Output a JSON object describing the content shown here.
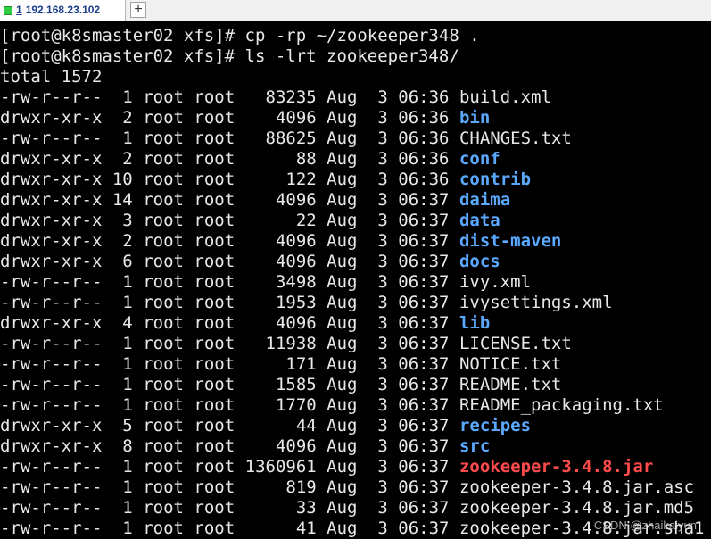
{
  "tab": {
    "index": "1",
    "title": "192.168.23.102",
    "status_color": "#2ecc40",
    "add_label": "+"
  },
  "terminal": {
    "lines": [
      {
        "kind": "text",
        "text": "[root@k8smaster02 xfs]# cp -rp ~/zookeeper348 ."
      },
      {
        "kind": "text",
        "text": "[root@k8smaster02 xfs]# ls -lrt zookeeper348/"
      },
      {
        "kind": "text",
        "text": "total 1572"
      },
      {
        "kind": "entry",
        "perms": "-rw-r--r--",
        "links": "1",
        "owner": "root",
        "group": "root",
        "size": "83235",
        "month": "Aug",
        "day": "3",
        "time": "06:36",
        "name": "build.xml",
        "type": "file"
      },
      {
        "kind": "entry",
        "perms": "drwxr-xr-x",
        "links": "2",
        "owner": "root",
        "group": "root",
        "size": "4096",
        "month": "Aug",
        "day": "3",
        "time": "06:36",
        "name": "bin",
        "type": "dir"
      },
      {
        "kind": "entry",
        "perms": "-rw-r--r--",
        "links": "1",
        "owner": "root",
        "group": "root",
        "size": "88625",
        "month": "Aug",
        "day": "3",
        "time": "06:36",
        "name": "CHANGES.txt",
        "type": "file"
      },
      {
        "kind": "entry",
        "perms": "drwxr-xr-x",
        "links": "2",
        "owner": "root",
        "group": "root",
        "size": "88",
        "month": "Aug",
        "day": "3",
        "time": "06:36",
        "name": "conf",
        "type": "dir"
      },
      {
        "kind": "entry",
        "perms": "drwxr-xr-x",
        "links": "10",
        "owner": "root",
        "group": "root",
        "size": "122",
        "month": "Aug",
        "day": "3",
        "time": "06:36",
        "name": "contrib",
        "type": "dir"
      },
      {
        "kind": "entry",
        "perms": "drwxr-xr-x",
        "links": "14",
        "owner": "root",
        "group": "root",
        "size": "4096",
        "month": "Aug",
        "day": "3",
        "time": "06:37",
        "name": "daima",
        "type": "dir"
      },
      {
        "kind": "entry",
        "perms": "drwxr-xr-x",
        "links": "3",
        "owner": "root",
        "group": "root",
        "size": "22",
        "month": "Aug",
        "day": "3",
        "time": "06:37",
        "name": "data",
        "type": "dir"
      },
      {
        "kind": "entry",
        "perms": "drwxr-xr-x",
        "links": "2",
        "owner": "root",
        "group": "root",
        "size": "4096",
        "month": "Aug",
        "day": "3",
        "time": "06:37",
        "name": "dist-maven",
        "type": "dir"
      },
      {
        "kind": "entry",
        "perms": "drwxr-xr-x",
        "links": "6",
        "owner": "root",
        "group": "root",
        "size": "4096",
        "month": "Aug",
        "day": "3",
        "time": "06:37",
        "name": "docs",
        "type": "dir"
      },
      {
        "kind": "entry",
        "perms": "-rw-r--r--",
        "links": "1",
        "owner": "root",
        "group": "root",
        "size": "3498",
        "month": "Aug",
        "day": "3",
        "time": "06:37",
        "name": "ivy.xml",
        "type": "file"
      },
      {
        "kind": "entry",
        "perms": "-rw-r--r--",
        "links": "1",
        "owner": "root",
        "group": "root",
        "size": "1953",
        "month": "Aug",
        "day": "3",
        "time": "06:37",
        "name": "ivysettings.xml",
        "type": "file"
      },
      {
        "kind": "entry",
        "perms": "drwxr-xr-x",
        "links": "4",
        "owner": "root",
        "group": "root",
        "size": "4096",
        "month": "Aug",
        "day": "3",
        "time": "06:37",
        "name": "lib",
        "type": "dir"
      },
      {
        "kind": "entry",
        "perms": "-rw-r--r--",
        "links": "1",
        "owner": "root",
        "group": "root",
        "size": "11938",
        "month": "Aug",
        "day": "3",
        "time": "06:37",
        "name": "LICENSE.txt",
        "type": "file"
      },
      {
        "kind": "entry",
        "perms": "-rw-r--r--",
        "links": "1",
        "owner": "root",
        "group": "root",
        "size": "171",
        "month": "Aug",
        "day": "3",
        "time": "06:37",
        "name": "NOTICE.txt",
        "type": "file"
      },
      {
        "kind": "entry",
        "perms": "-rw-r--r--",
        "links": "1",
        "owner": "root",
        "group": "root",
        "size": "1585",
        "month": "Aug",
        "day": "3",
        "time": "06:37",
        "name": "README.txt",
        "type": "file"
      },
      {
        "kind": "entry",
        "perms": "-rw-r--r--",
        "links": "1",
        "owner": "root",
        "group": "root",
        "size": "1770",
        "month": "Aug",
        "day": "3",
        "time": "06:37",
        "name": "README_packaging.txt",
        "type": "file"
      },
      {
        "kind": "entry",
        "perms": "drwxr-xr-x",
        "links": "5",
        "owner": "root",
        "group": "root",
        "size": "44",
        "month": "Aug",
        "day": "3",
        "time": "06:37",
        "name": "recipes",
        "type": "dir"
      },
      {
        "kind": "entry",
        "perms": "drwxr-xr-x",
        "links": "8",
        "owner": "root",
        "group": "root",
        "size": "4096",
        "month": "Aug",
        "day": "3",
        "time": "06:37",
        "name": "src",
        "type": "dir"
      },
      {
        "kind": "entry",
        "perms": "-rw-r--r--",
        "links": "1",
        "owner": "root",
        "group": "root",
        "size": "1360961",
        "month": "Aug",
        "day": "3",
        "time": "06:37",
        "name": "zookeeper-3.4.8.jar",
        "type": "archive"
      },
      {
        "kind": "entry",
        "perms": "-rw-r--r--",
        "links": "1",
        "owner": "root",
        "group": "root",
        "size": "819",
        "month": "Aug",
        "day": "3",
        "time": "06:37",
        "name": "zookeeper-3.4.8.jar.asc",
        "type": "file"
      },
      {
        "kind": "entry",
        "perms": "-rw-r--r--",
        "links": "1",
        "owner": "root",
        "group": "root",
        "size": "33",
        "month": "Aug",
        "day": "3",
        "time": "06:37",
        "name": "zookeeper-3.4.8.jar.md5",
        "type": "file"
      },
      {
        "kind": "entry",
        "perms": "-rw-r--r--",
        "links": "1",
        "owner": "root",
        "group": "root",
        "size": "41",
        "month": "Aug",
        "day": "3",
        "time": "06:37",
        "name": "zookeeper-3.4.8.jar.sha1",
        "type": "file"
      }
    ]
  },
  "watermark": "CSDN @zhaikaiyun",
  "colors": {
    "background": "#000000",
    "foreground": "#e8e8e8",
    "directory": "#5aa9ff",
    "archive": "#ff4b4b"
  }
}
